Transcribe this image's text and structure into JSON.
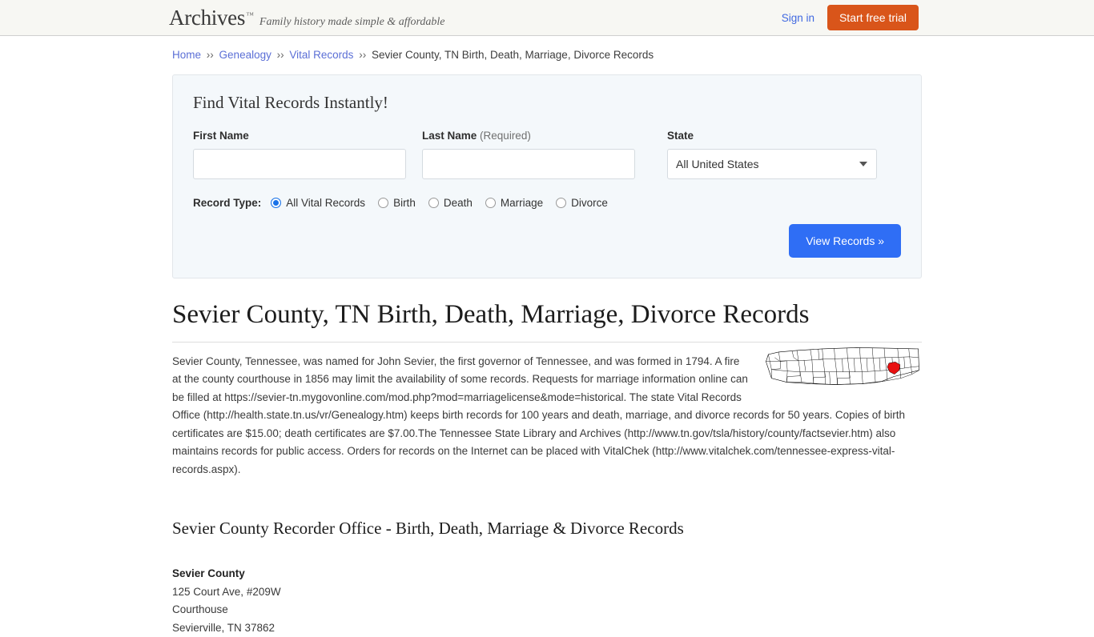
{
  "header": {
    "brand": "Archives",
    "trademark": "™",
    "tagline": "Family history made simple & affordable",
    "sign_in_label": "Sign in",
    "start_trial_label": "Start free trial",
    "trial_color": "#d9551a",
    "link_color": "#4169e1"
  },
  "breadcrumb": {
    "separator": "››",
    "items": [
      {
        "label": "Home",
        "link": true
      },
      {
        "label": "Genealogy",
        "link": true
      },
      {
        "label": "Vital Records",
        "link": true
      },
      {
        "label": "Sevier County, TN Birth, Death, Marriage, Divorce Records",
        "link": false
      }
    ]
  },
  "search_panel": {
    "title": "Find Vital Records Instantly!",
    "first_name": {
      "label": "First Name",
      "value": "",
      "placeholder": ""
    },
    "last_name": {
      "label": "Last Name",
      "required_note": "(Required)",
      "value": "",
      "placeholder": ""
    },
    "state": {
      "label": "State",
      "selected": "All United States",
      "caret_icon": "chevron-down-icon"
    },
    "record_type": {
      "label": "Record Type:",
      "options": [
        {
          "label": "All Vital Records",
          "selected": true
        },
        {
          "label": "Birth",
          "selected": false
        },
        {
          "label": "Death",
          "selected": false
        },
        {
          "label": "Marriage",
          "selected": false
        },
        {
          "label": "Divorce",
          "selected": false
        }
      ],
      "selected_color": "#1a73e8"
    },
    "submit_label": "View Records »",
    "submit_color": "#2f6ef5"
  },
  "article": {
    "heading": "Sevier County, TN Birth, Death, Marriage, Divorce Records",
    "intro": "Sevier County, Tennessee, was named for John Sevier, the first governor of Tennessee, and was formed in 1794. A fire at the county courthouse in 1856 may limit the availability of some records. Requests for marriage information online can be filled at https://sevier-tn.mygovonline.com/mod.php?mod=marriagelicense&mode=historical. The state Vital Records Office (http://health.state.tn.us/vr/Genealogy.htm) keeps birth records for 100 years and death, marriage, and divorce records for 50 years. Copies of birth certificates are $15.00; death certificates are $7.00.The Tennessee State Library and Archives (http://www.tn.gov/tsla/history/county/factsevier.htm) also maintains records for public access. Orders for records on the Internet can be placed with VitalChek (http://www.vitalchek.com/tennessee-express-vital-records.aspx).",
    "map": {
      "name": "tennessee-county-map",
      "highlight_county": "Sevier",
      "highlight_color": "#e81010"
    },
    "sub_heading": "Sevier County Recorder Office - Birth, Death, Marriage & Divorce Records",
    "address": {
      "name": "Sevier County",
      "lines": [
        "125 Court Ave, #209W",
        "Courthouse",
        "Sevierville, TN 37862"
      ]
    }
  }
}
